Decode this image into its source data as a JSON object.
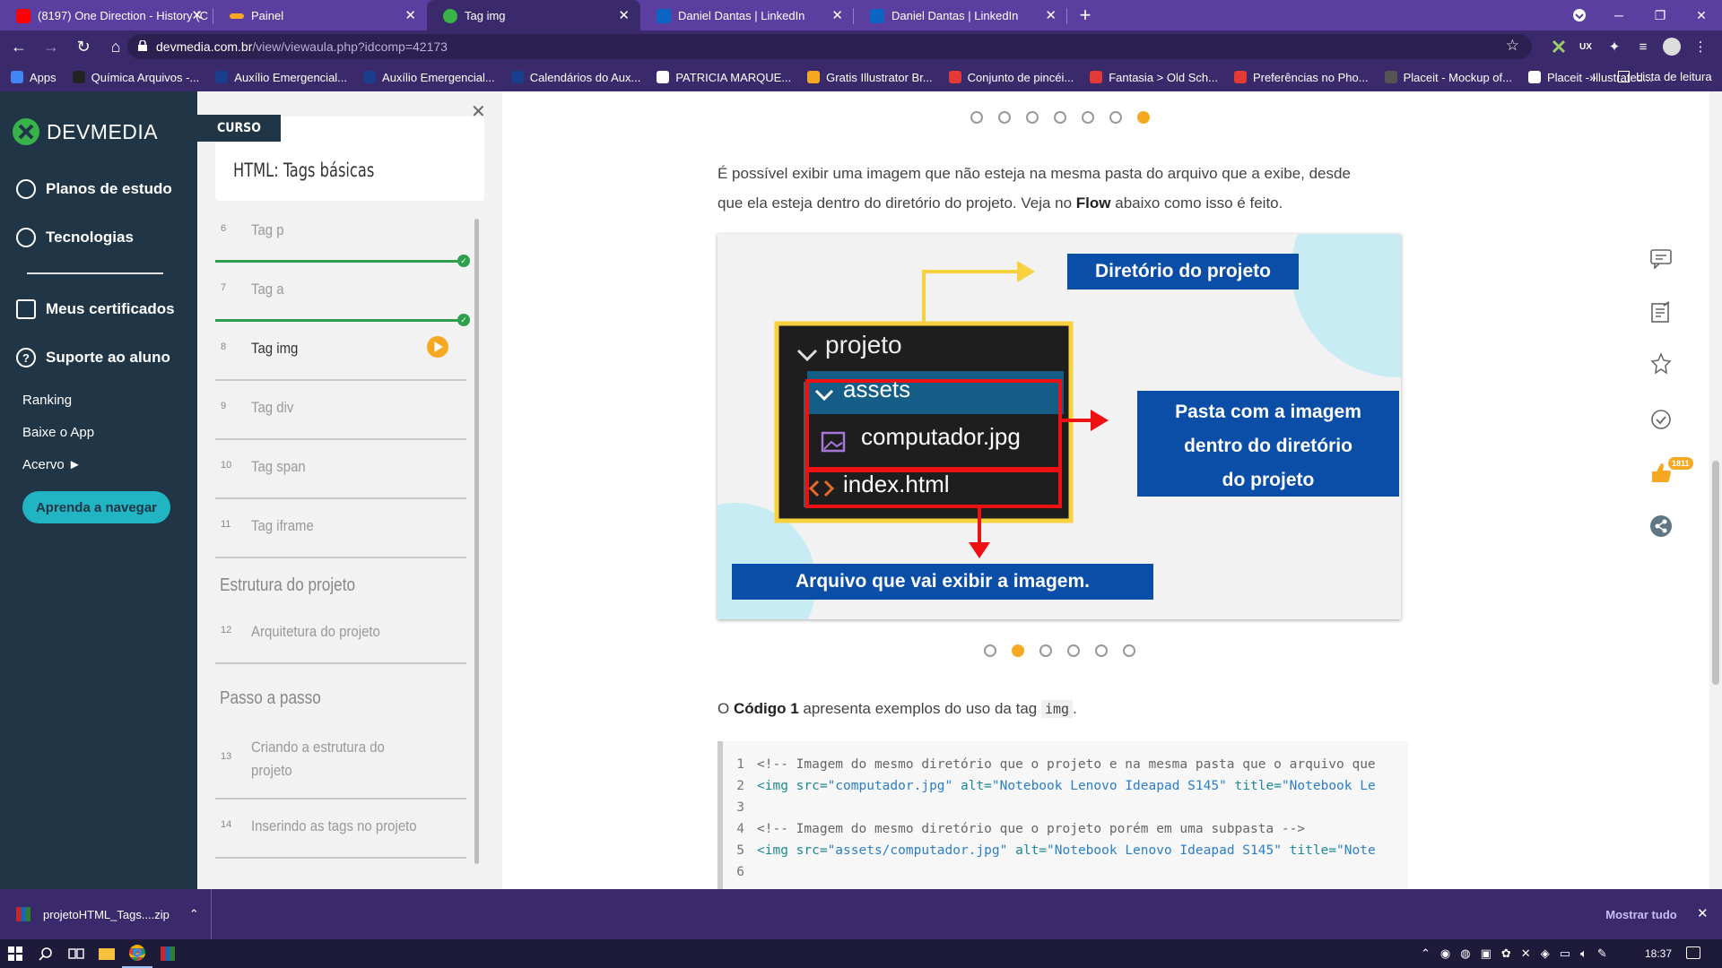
{
  "browser": {
    "tabs": [
      {
        "title": "(8197) One Direction - History (C",
        "color": "#ff0000"
      },
      {
        "title": "Painel",
        "color": "#f7a823"
      },
      {
        "title": "Tag img",
        "color": "#37b34a"
      },
      {
        "title": "Daniel Dantas | LinkedIn",
        "color": "#0a66c2"
      },
      {
        "title": "Daniel Dantas | LinkedIn",
        "color": "#0a66c2"
      }
    ],
    "new_tab": "+",
    "url_host": "devmedia.com.br",
    "url_path": "/view/viewaula.php?idcomp=42173",
    "bookmarks": [
      {
        "label": "Apps",
        "color": "#4285f4"
      },
      {
        "label": "Química Arquivos -...",
        "color": "#222222"
      },
      {
        "label": "Auxílio Emergencial...",
        "color": "#1a3e8c"
      },
      {
        "label": "Auxílio Emergencial...",
        "color": "#1a3e8c"
      },
      {
        "label": "Calendários do Aux...",
        "color": "#1a3e8c"
      },
      {
        "label": "PATRICIA MARQUE...",
        "color": "#ffffff"
      },
      {
        "label": "Gratis Illustrator Br...",
        "color": "#f7a823"
      },
      {
        "label": "Conjunto de pincéi...",
        "color": "#e53935"
      },
      {
        "label": "Fantasia > Old Sch...",
        "color": "#e53935"
      },
      {
        "label": "Preferências no Pho...",
        "color": "#e53935"
      },
      {
        "label": "Placeit - Mockup of...",
        "color": "#555555"
      },
      {
        "label": "Placeit - Illustrated...",
        "color": "#ffffff"
      }
    ],
    "reading_list": "Lista de leitura",
    "more": "»"
  },
  "site_sidebar": {
    "logo": "DEVMEDIA",
    "nav": [
      "Planos de estudo",
      "Tecnologias",
      "Meus certificados",
      "Suporte ao aluno"
    ],
    "links": [
      "Ranking",
      "Baixe o App",
      "Acervo ►"
    ],
    "cta": "Aprenda a navegar"
  },
  "course": {
    "badge": "CURSO",
    "title": "HTML: Tags básicas",
    "lessons": [
      {
        "num": "6",
        "label": "Tag p"
      },
      {
        "num": "7",
        "label": "Tag a"
      },
      {
        "num": "8",
        "label": "Tag img"
      },
      {
        "num": "9",
        "label": "Tag div"
      },
      {
        "num": "10",
        "label": "Tag span"
      },
      {
        "num": "11",
        "label": "Tag iframe"
      }
    ],
    "section1": "Estrutura do projeto",
    "lesson12": {
      "num": "12",
      "label": "Arquitetura do projeto"
    },
    "section2": "Passo a passo",
    "lesson13": {
      "num": "13",
      "label_1": "Criando a estrutura do",
      "label_2": "projeto"
    },
    "lesson14": {
      "num": "14",
      "label": "Inserindo as tags no projeto"
    }
  },
  "article": {
    "para1_a": "É possível exibir uma imagem que não esteja na mesma pasta do arquivo que a exibe, desde",
    "para1_b": "que ela esteja dentro do diretório do projeto. Veja no ",
    "para1_bold": "Flow",
    "para1_c": " abaixo como isso é feito.",
    "flow": {
      "label_dir": "Diretório do projeto",
      "folder": "projeto",
      "subfolder": "assets",
      "image_file": "computador.jpg",
      "html_file": "index.html",
      "label_folder_1": "Pasta com a imagem",
      "label_folder_2": "dentro do diretório",
      "label_folder_3": "do projeto",
      "label_file": "Arquivo que vai exibir a imagem."
    },
    "para2_a": "O ",
    "para2_bold": "Código 1",
    "para2_b": " apresenta exemplos do uso da tag ",
    "para2_code": "img",
    "para2_c": ".",
    "code_lines": [
      {
        "n": "1",
        "comment": "<!-- Imagem do mesmo diretório que o projeto e na mesma pasta que o arquivo que"
      },
      {
        "n": "2",
        "tag": "<img",
        "a1": " src=",
        "v1": "\"computador.jpg\"",
        "a2": " alt=",
        "v2": "\"Notebook Lenovo Ideapad S145\"",
        "a3": " title=",
        "v3": "\"Notebook Le"
      },
      {
        "n": "3"
      },
      {
        "n": "4",
        "comment": "<!-- Imagem do mesmo diretório que o projeto porém em uma subpasta -->"
      },
      {
        "n": "5",
        "tag": "<img",
        "a1": " src=",
        "v1": "\"assets/computador.jpg\"",
        "a2": " alt=",
        "v2": "\"Notebook Lenovo Ideapad S145\"",
        "a3": " title=",
        "v3": "\"Note"
      },
      {
        "n": "6"
      }
    ],
    "likes": "1811"
  },
  "downloads": {
    "file": "projetoHTML_Tags....zip",
    "show_all": "Mostrar tudo"
  },
  "taskbar": {
    "time": "18:37"
  },
  "colors": {
    "accent": "#f7a823",
    "sidebar": "#203545",
    "done": "#2e9e4f",
    "browser": "#3a2a6c"
  }
}
